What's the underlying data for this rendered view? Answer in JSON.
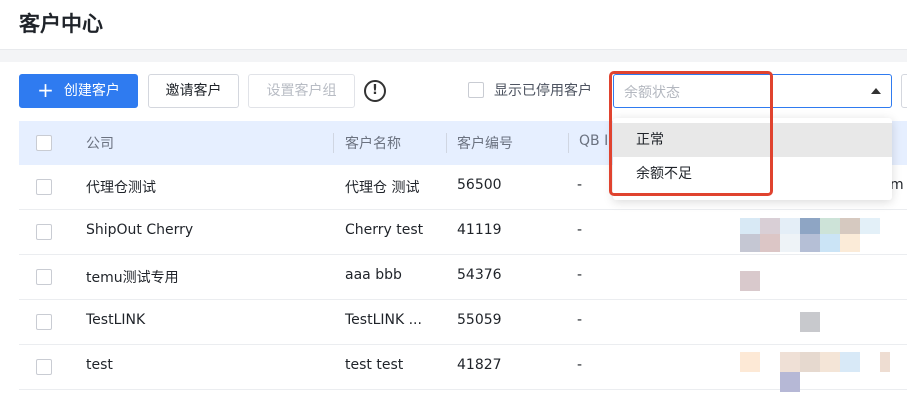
{
  "header": {
    "title": "客户中心"
  },
  "toolbar": {
    "create_label": "创建客户",
    "invite_label": "邀请客户",
    "set_group_label": "设置客户组",
    "info_glyph": "!",
    "show_disabled_label": "显示已停用客户",
    "balance_placeholder": "余额状态"
  },
  "dropdown": {
    "options": [
      "正常",
      "余额不足"
    ]
  },
  "table": {
    "columns": [
      "公司",
      "客户名称",
      "客户编号",
      "QB I"
    ],
    "rows": [
      {
        "company": "代理仓测试",
        "name": "代理仓 测试",
        "number": "56500",
        "qb": "-"
      },
      {
        "company": "ShipOut Cherry",
        "name": "Cherry test",
        "number": "41119",
        "qb": "-"
      },
      {
        "company": "temu测试专用",
        "name": "aaa bbb",
        "number": "54376",
        "qb": "-"
      },
      {
        "company": "TestLINK",
        "name": "TestLINK ...",
        "number": "55059",
        "qb": "-"
      },
      {
        "company": "test",
        "name": "test test",
        "number": "41827",
        "qb": "-"
      }
    ],
    "tail_text": "m"
  },
  "colors": {
    "primary": "#2f7bf0",
    "highlight": "#e0432f",
    "header_bg": "#e6efff"
  },
  "icons": {
    "plus": "plus-icon",
    "info": "info-circle-icon",
    "caret": "caret-up-icon"
  }
}
